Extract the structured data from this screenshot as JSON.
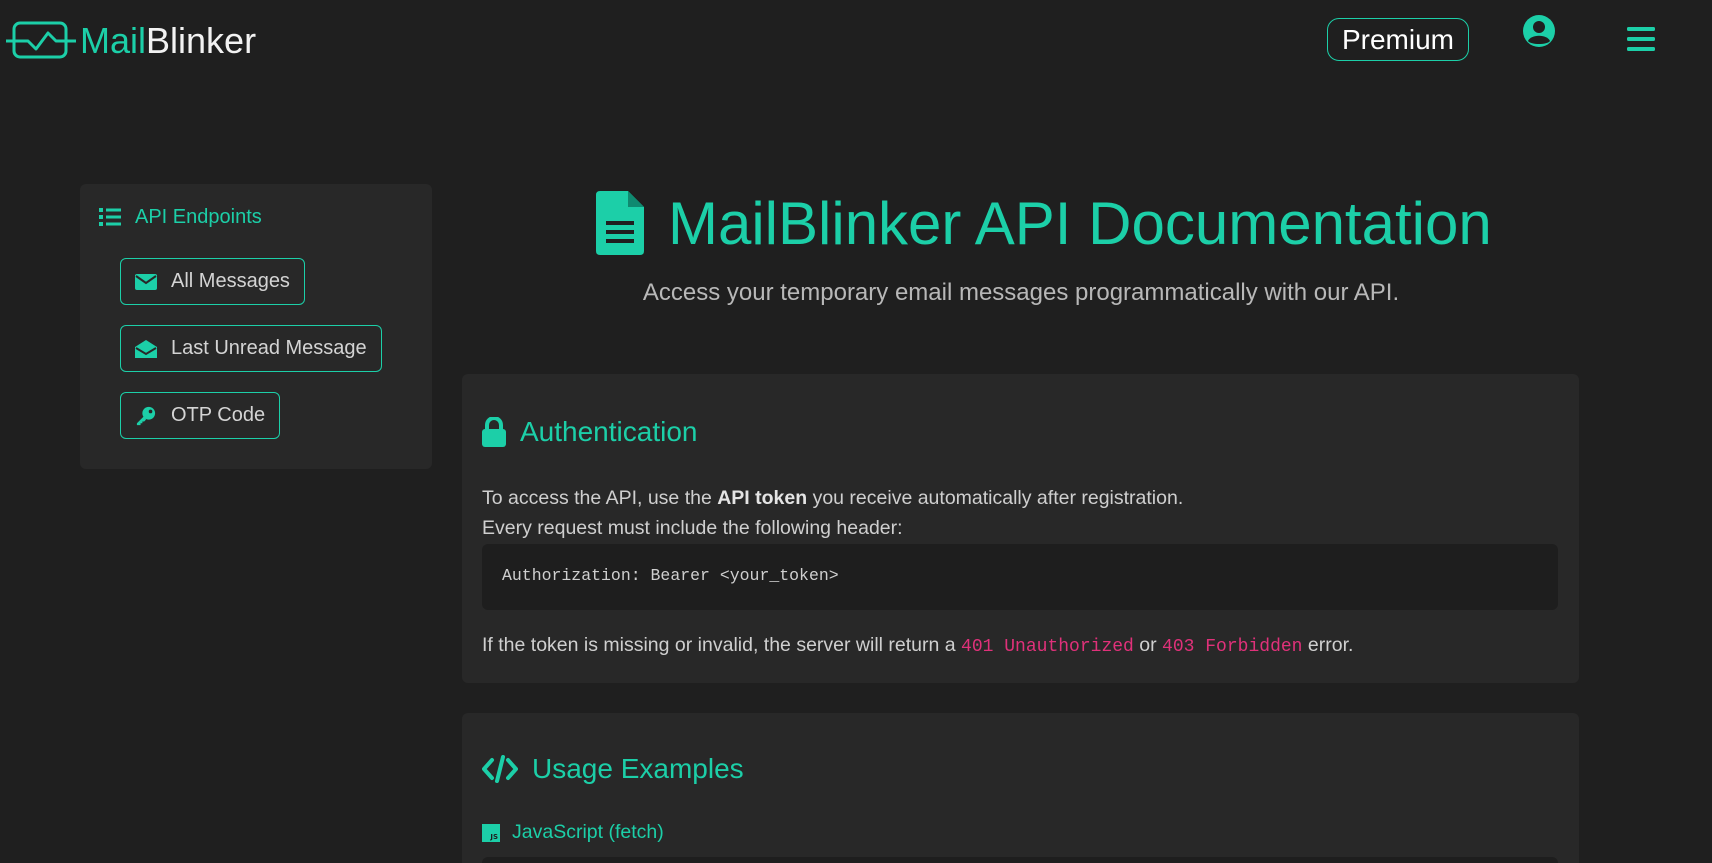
{
  "header": {
    "logo_part1": "Mail",
    "logo_part2": "Blinker",
    "premium_label": "Premium"
  },
  "sidebar": {
    "title": "API Endpoints",
    "items": [
      {
        "label": "All Messages",
        "icon": "envelope-icon"
      },
      {
        "label": "Last Unread Message",
        "icon": "envelope-open-icon"
      },
      {
        "label": "OTP Code",
        "icon": "key-icon"
      }
    ]
  },
  "main": {
    "title": "MailBlinker API Documentation",
    "subtitle": "Access your temporary email messages programmatically with our API."
  },
  "auth": {
    "heading": "Authentication",
    "p1_before": "To access the API, use the ",
    "p1_bold": "API token",
    "p1_after": " you receive automatically after registration.",
    "p2": "Every request must include the following header:",
    "code": "Authorization: Bearer <your_token>",
    "p3_before": "If the token is missing or invalid, the server will return a ",
    "p3_code1": "401 Unauthorized",
    "p3_mid": " or ",
    "p3_code2": "403 Forbidden",
    "p3_after": " error."
  },
  "usage": {
    "heading": "Usage Examples",
    "lang_label": "JavaScript (fetch)",
    "js_badge": "JS"
  },
  "colors": {
    "accent": "#1ccfa8",
    "background": "#1f1f1f",
    "card": "#282828",
    "code_highlight": "#e0317a"
  }
}
